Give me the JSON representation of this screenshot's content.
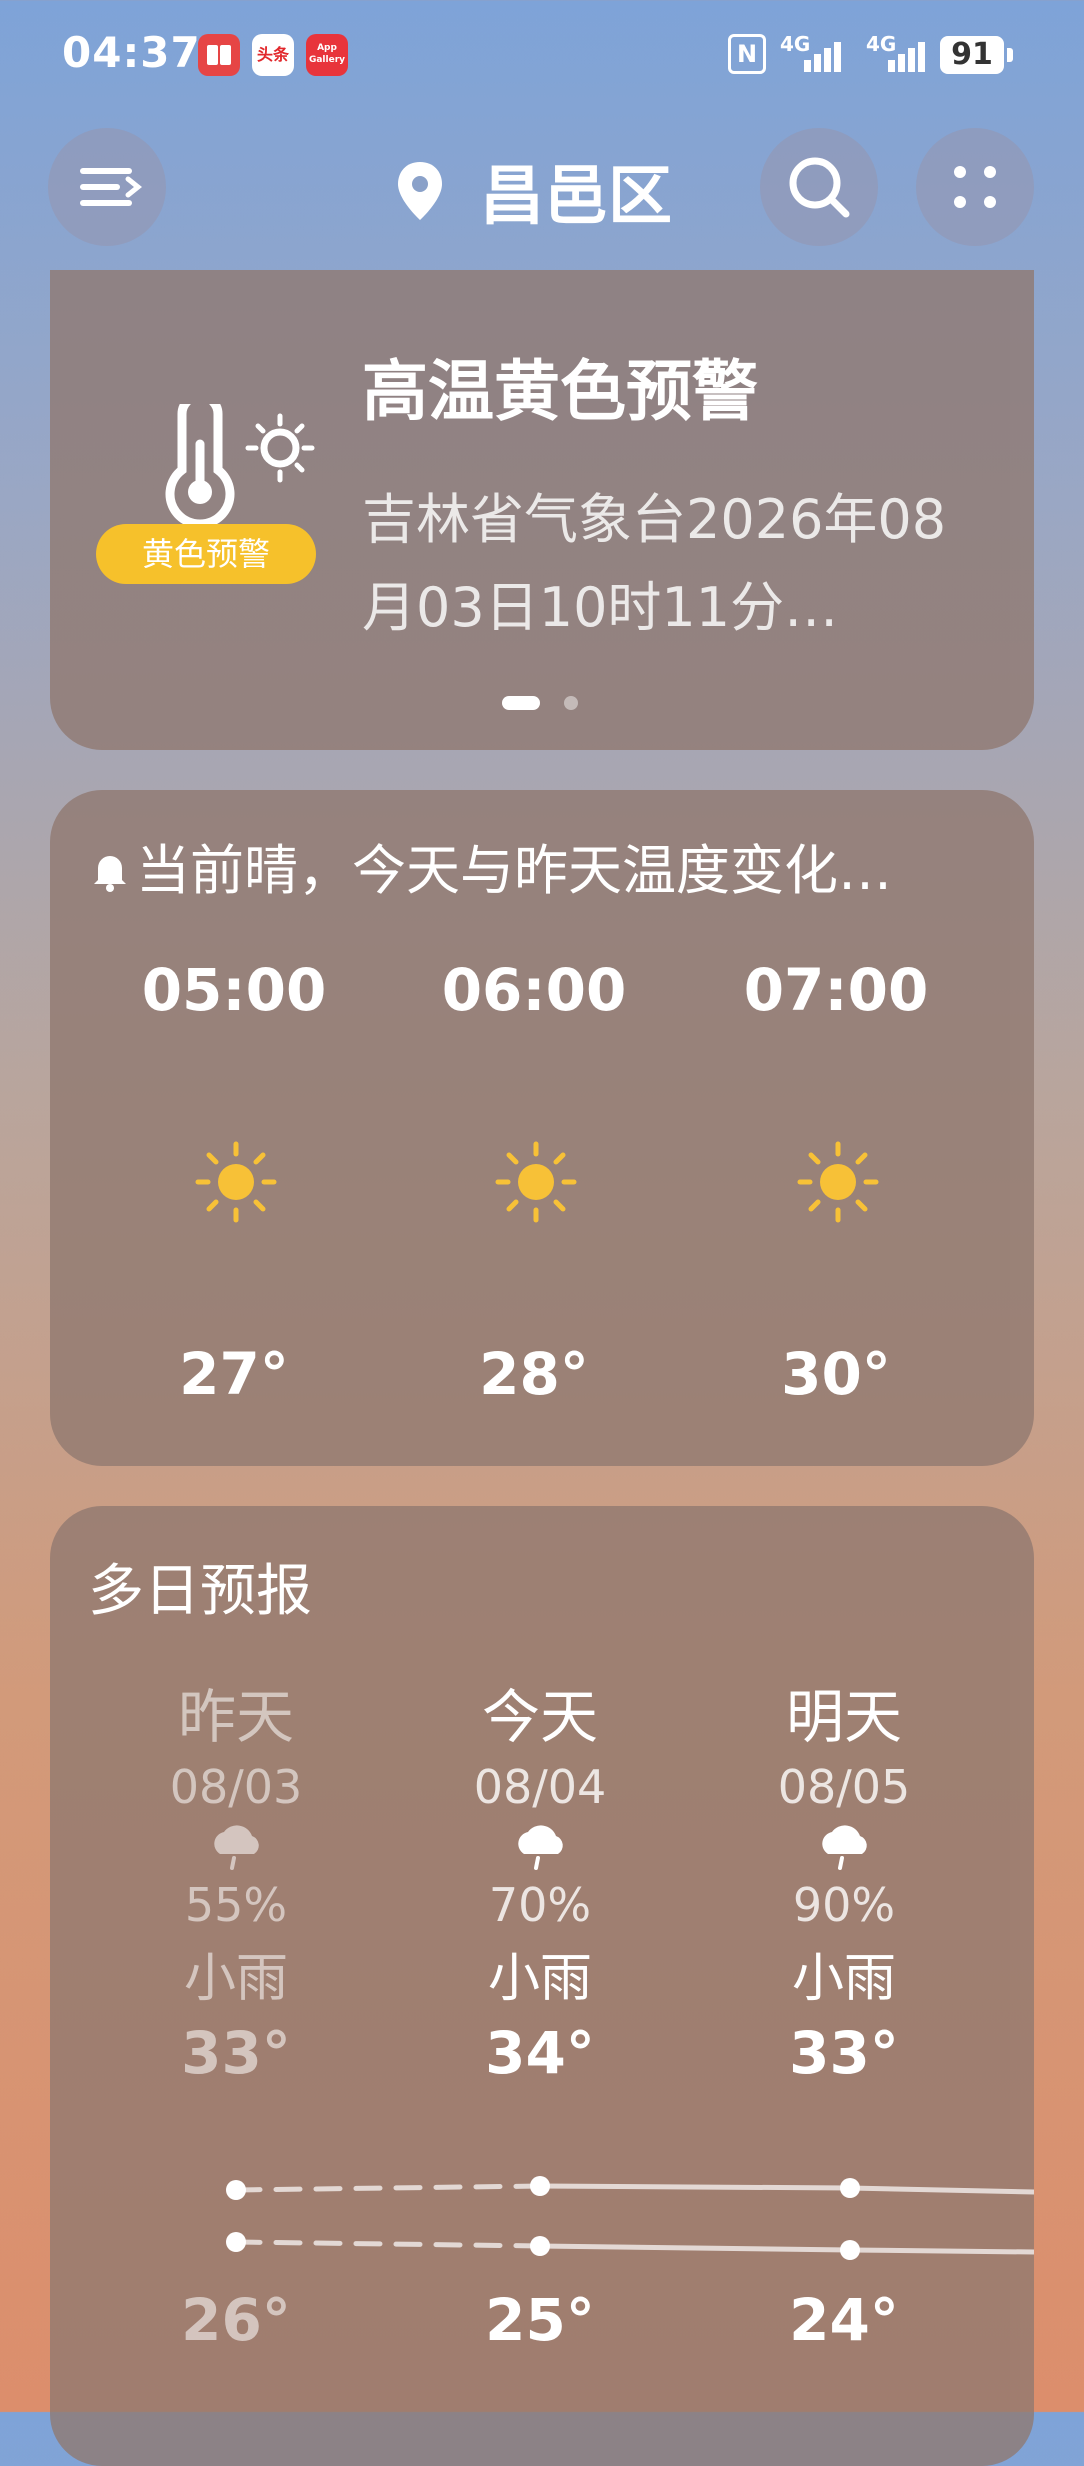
{
  "status_bar": {
    "time": "04:37",
    "apps": [
      "阅读",
      "头条",
      "App Gallery"
    ],
    "network1": "4G",
    "network2": "4G",
    "battery": "91"
  },
  "header": {
    "location": "昌邑区",
    "icons": [
      "menu-icon",
      "location-pin-icon",
      "search-icon",
      "more-dots-icon"
    ]
  },
  "warning": {
    "title": "高温黄色预警",
    "text": "吉林省气象台2026年08月03日10时11分…",
    "badge": "黄色预警",
    "page_count": 2,
    "active_page": 1,
    "badge_color": "#f6c12b"
  },
  "hourly": {
    "note": "当前晴，今天与昨天温度变化…",
    "items": [
      {
        "time": "05:00",
        "icon": "sun-icon",
        "temp": "27°"
      },
      {
        "time": "06:00",
        "icon": "sun-icon",
        "temp": "28°"
      },
      {
        "time": "07:00",
        "icon": "sun-icon",
        "temp": "30°"
      }
    ]
  },
  "forecast": {
    "title": "多日预报",
    "days": [
      {
        "day": "昨天",
        "date": "08/03",
        "icon": "cloud-rain-icon",
        "pct": "55%",
        "desc": "小雨",
        "high": "33°",
        "low": "26°"
      },
      {
        "day": "今天",
        "date": "08/04",
        "icon": "cloud-rain-icon",
        "pct": "70%",
        "desc": "小雨",
        "high": "34°",
        "low": "25°"
      },
      {
        "day": "明天",
        "date": "08/05",
        "icon": "cloud-rain-icon",
        "pct": "90%",
        "desc": "小雨",
        "high": "33°",
        "low": "24°"
      }
    ]
  },
  "colors": {
    "sun": "#f7c137",
    "card": "#90786f"
  }
}
